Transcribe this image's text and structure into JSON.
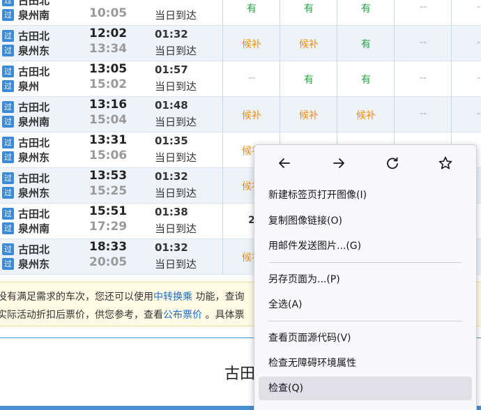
{
  "rows": [
    {
      "from": "古田北",
      "to": "泉州南",
      "dep": "",
      "arr": "10:05",
      "dur": "",
      "arrday": "当日到达",
      "seats": [
        "有",
        "有",
        "有",
        "--",
        "--"
      ]
    },
    {
      "from": "古田北",
      "to": "泉州东",
      "dep": "12:02",
      "arr": "13:34",
      "dur": "01:32",
      "arrday": "当日到达",
      "seats": [
        "候补",
        "候补",
        "有",
        "--",
        "--"
      ]
    },
    {
      "from": "古田北",
      "to": "泉州",
      "dep": "13:05",
      "arr": "15:02",
      "dur": "01:57",
      "arrday": "当日到达",
      "seats": [
        "--",
        "有",
        "有",
        "--",
        "--"
      ]
    },
    {
      "from": "古田北",
      "to": "泉州南",
      "dep": "13:16",
      "arr": "15:04",
      "dur": "01:48",
      "arrday": "当日到达",
      "seats": [
        "候补",
        "候补",
        "候补",
        "--",
        "--"
      ]
    },
    {
      "from": "古田北",
      "to": "泉州东",
      "dep": "13:31",
      "arr": "15:06",
      "dur": "01:35",
      "arrday": "当日到达",
      "seats": [
        "候补",
        "",
        "",
        "",
        ""
      ]
    },
    {
      "from": "古田北",
      "to": "泉州东",
      "dep": "13:53",
      "arr": "15:25",
      "dur": "01:32",
      "arrday": "当日到达",
      "seats": [
        "候补",
        "",
        "",
        "",
        ""
      ]
    },
    {
      "from": "古田北",
      "to": "泉州南",
      "dep": "15:51",
      "arr": "17:29",
      "dur": "01:38",
      "arrday": "当日到达",
      "seats": [
        "2",
        "",
        "",
        "",
        ""
      ]
    },
    {
      "from": "古田北",
      "to": "泉州东",
      "dep": "18:33",
      "arr": "20:05",
      "dur": "01:32",
      "arrday": "当日到达",
      "seats": [
        "候补",
        "",
        "",
        "",
        ""
      ]
    }
  ],
  "badge_text": "过",
  "notice": {
    "line1_prefix": "没有满足需求的车次，您还可以使用",
    "line1_link": "中转换乘",
    "line1_suffix": " 功能，查询",
    "line2_prefix": "实际活动折扣后票价，供您参考，查看",
    "line2_link": "公布票价",
    "line2_suffix": " 。具体票"
  },
  "bottom_title": "古田",
  "context_menu": {
    "nav": [
      {
        "icon": "back-arrow-icon"
      },
      {
        "icon": "forward-arrow-icon"
      },
      {
        "icon": "reload-icon"
      },
      {
        "icon": "bookmark-star-icon"
      }
    ],
    "items": [
      "新建标签页打开图像(I)",
      "复制图像链接(O)",
      "用邮件发送图片...(G)",
      "另存页面为...(P)",
      "全选(A)",
      "查看页面源代码(V)",
      "检查无障碍环境属性",
      "检查(Q)"
    ]
  }
}
